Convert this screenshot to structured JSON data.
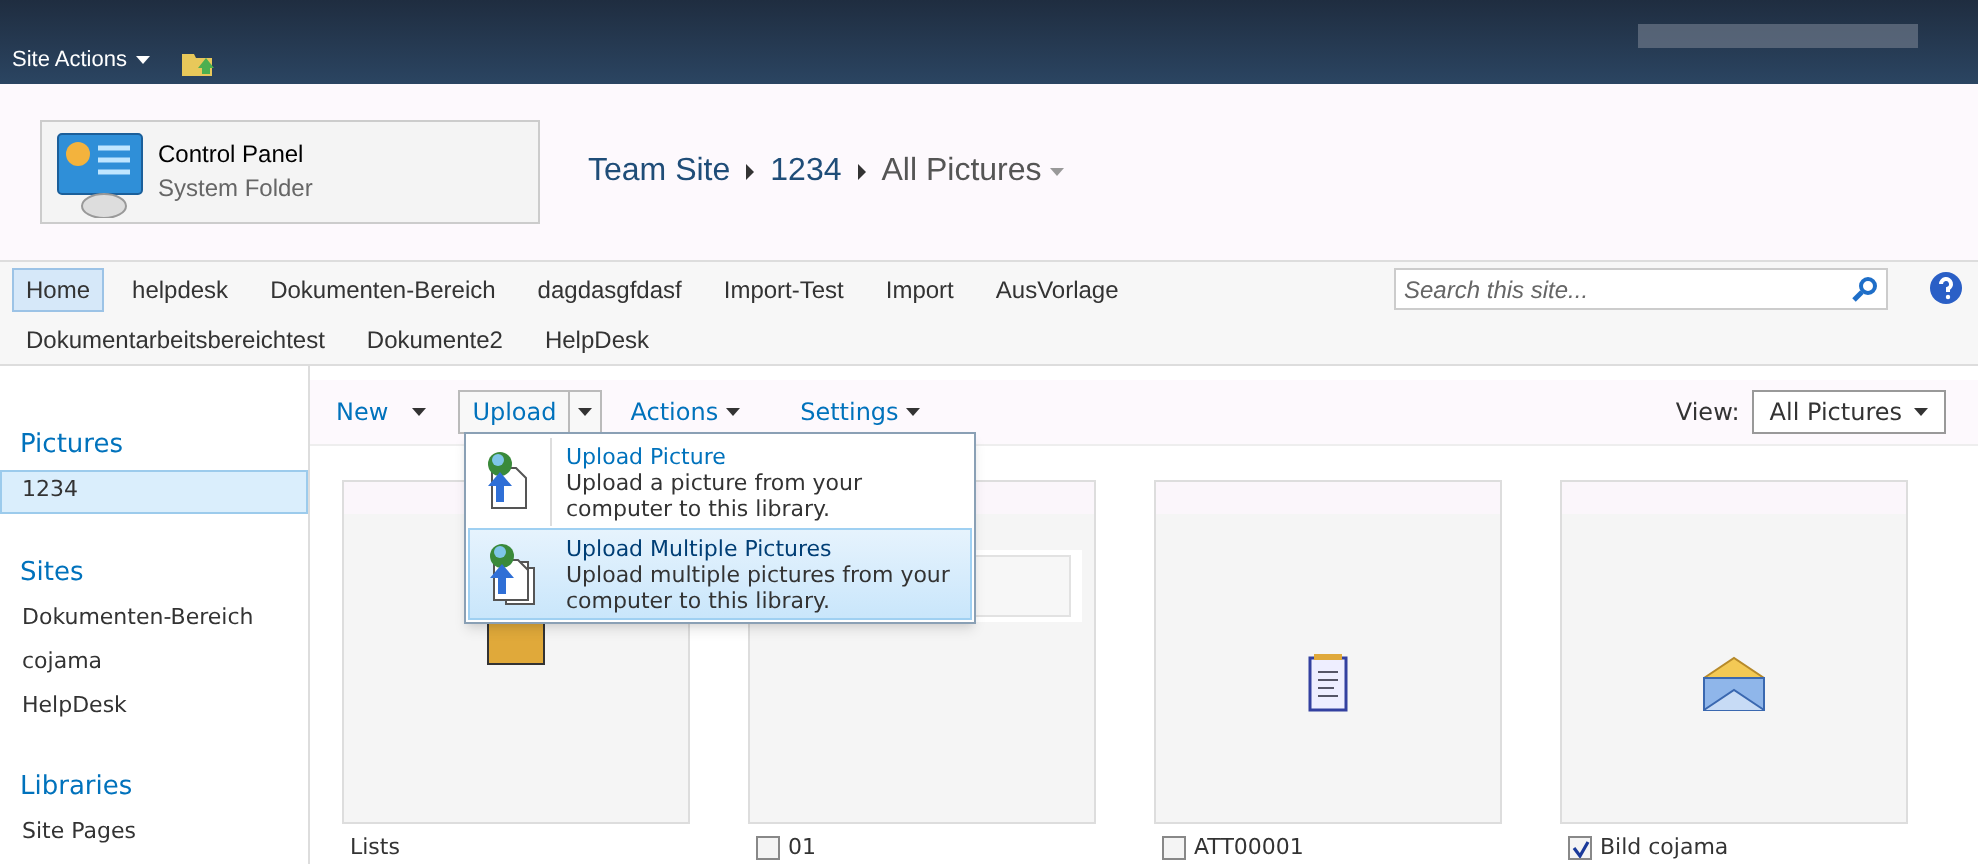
{
  "top_bar": {
    "site_actions": "Site Actions"
  },
  "header": {
    "logo": {
      "title": "Control Panel",
      "subtitle": "System Folder"
    },
    "breadcrumb": [
      "Team Site",
      "1234"
    ],
    "current_page": "All Pictures"
  },
  "top_nav": {
    "items": [
      {
        "label": "Home",
        "selected": true
      },
      {
        "label": "helpdesk",
        "selected": false
      },
      {
        "label": "Dokumenten-Bereich",
        "selected": false
      },
      {
        "label": "dagdasgfdasf",
        "selected": false
      },
      {
        "label": "Import-Test",
        "selected": false
      },
      {
        "label": "Import",
        "selected": false
      },
      {
        "label": "AusVorlage",
        "selected": false
      },
      {
        "label": "Dokumentarbeitsbereichtest",
        "selected": false
      },
      {
        "label": "Dokumente2",
        "selected": false
      },
      {
        "label": "HelpDesk",
        "selected": false
      }
    ],
    "search": {
      "placeholder": "Search this site..."
    }
  },
  "sidebar": {
    "sections": [
      {
        "title": "Pictures",
        "items": [
          {
            "label": "1234",
            "selected": true
          }
        ]
      },
      {
        "title": "Sites",
        "items": [
          {
            "label": "Dokumenten-Bereich",
            "selected": false
          },
          {
            "label": "cojama",
            "selected": false
          },
          {
            "label": "HelpDesk",
            "selected": false
          }
        ]
      },
      {
        "title": "Libraries",
        "items": [
          {
            "label": "Site Pages",
            "selected": false
          }
        ]
      }
    ]
  },
  "toolbar": {
    "new": "New",
    "upload": "Upload",
    "actions": "Actions",
    "settings": "Settings",
    "view_label": "View:",
    "view_value": "All Pictures"
  },
  "upload_menu": [
    {
      "title": "Upload Picture",
      "description": "Upload a picture from your computer to this library.",
      "selected": false,
      "kind": "single"
    },
    {
      "title": "Upload Multiple Pictures",
      "description": "Upload multiple pictures from your computer to this library.",
      "selected": true,
      "kind": "multiple"
    }
  ],
  "tiles": [
    {
      "kind": "folder",
      "name": "Lists"
    },
    {
      "kind": "picture",
      "name": "01",
      "checked": false
    },
    {
      "kind": "document",
      "name": "ATT00001",
      "checked": false
    },
    {
      "kind": "mail",
      "name": "Bild cojama",
      "checked": true
    }
  ]
}
